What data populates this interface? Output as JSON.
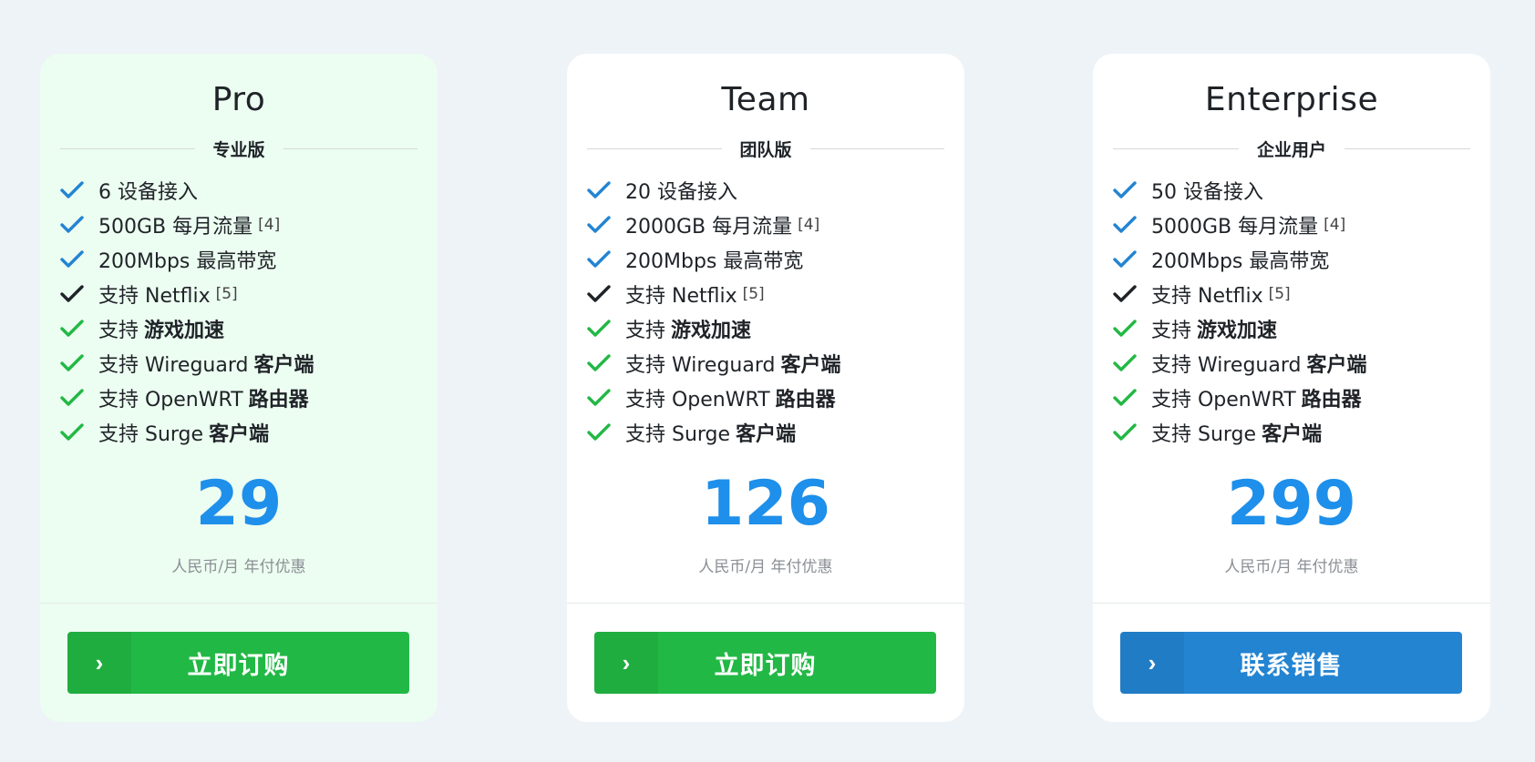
{
  "colors": {
    "check_blue": "#2384d2",
    "check_black": "#1f2328",
    "check_green": "#22b845",
    "price": "#1e8fea",
    "button_green": "#22b845",
    "button_blue": "#2384d2",
    "highlight_card": "#ecfdf1"
  },
  "plans": [
    {
      "name": "Pro",
      "subtitle": "专业版",
      "features": [
        {
          "text": "6 设备接入",
          "icon": "check-icon-blue"
        },
        {
          "text": "500GB 每月流量",
          "note": "[4]",
          "icon": "check-icon-blue"
        },
        {
          "text": "200Mbps 最高带宽",
          "icon": "check-icon-blue"
        },
        {
          "text": "支持 Netflix",
          "note": "[5]",
          "icon": "check-icon-black"
        },
        {
          "text": "支持",
          "bold": "游戏加速",
          "icon": "check-icon-green"
        },
        {
          "text": "支持 Wireguard",
          "bold": "客户端",
          "icon": "check-icon-green"
        },
        {
          "text": "支持 OpenWRT",
          "bold": "路由器",
          "icon": "check-icon-green"
        },
        {
          "text": "支持 Surge",
          "bold": "客户端",
          "icon": "check-icon-green"
        }
      ],
      "price": "29",
      "price_note": "人民币/月 年付优惠",
      "button_label": "立即订购",
      "button_icon": "chevron-right-icon"
    },
    {
      "name": "Team",
      "subtitle": "团队版",
      "features": [
        {
          "text": "20 设备接入",
          "icon": "check-icon-blue"
        },
        {
          "text": "2000GB 每月流量",
          "note": "[4]",
          "icon": "check-icon-blue"
        },
        {
          "text": "200Mbps 最高带宽",
          "icon": "check-icon-blue"
        },
        {
          "text": "支持 Netflix",
          "note": "[5]",
          "icon": "check-icon-black"
        },
        {
          "text": "支持",
          "bold": "游戏加速",
          "icon": "check-icon-green"
        },
        {
          "text": "支持 Wireguard",
          "bold": "客户端",
          "icon": "check-icon-green"
        },
        {
          "text": "支持 OpenWRT",
          "bold": "路由器",
          "icon": "check-icon-green"
        },
        {
          "text": "支持 Surge",
          "bold": "客户端",
          "icon": "check-icon-green"
        }
      ],
      "price": "126",
      "price_note": "人民币/月 年付优惠",
      "button_label": "立即订购",
      "button_icon": "chevron-right-icon"
    },
    {
      "name": "Enterprise",
      "subtitle": "企业用户",
      "features": [
        {
          "text": "50 设备接入",
          "icon": "check-icon-blue"
        },
        {
          "text": "5000GB 每月流量",
          "note": "[4]",
          "icon": "check-icon-blue"
        },
        {
          "text": "200Mbps 最高带宽",
          "icon": "check-icon-blue"
        },
        {
          "text": "支持 Netflix",
          "note": "[5]",
          "icon": "check-icon-black"
        },
        {
          "text": "支持",
          "bold": "游戏加速",
          "icon": "check-icon-green"
        },
        {
          "text": "支持 Wireguard",
          "bold": "客户端",
          "icon": "check-icon-green"
        },
        {
          "text": "支持 OpenWRT",
          "bold": "路由器",
          "icon": "check-icon-green"
        },
        {
          "text": "支持 Surge",
          "bold": "客户端",
          "icon": "check-icon-green"
        }
      ],
      "price": "299",
      "price_note": "人民币/月 年付优惠",
      "button_label": "联系销售",
      "button_icon": "chevron-right-icon"
    }
  ]
}
